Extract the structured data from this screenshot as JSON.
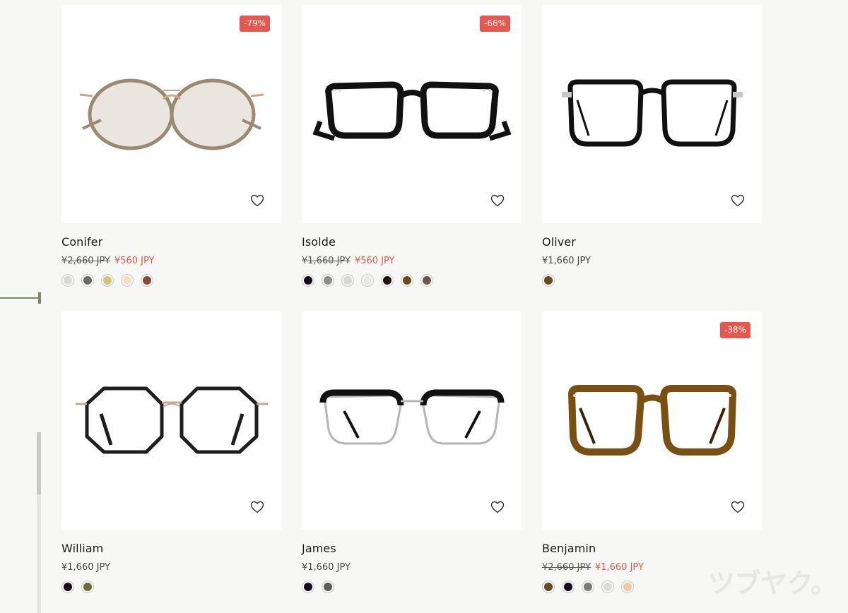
{
  "products": [
    {
      "name": "Conifer",
      "old_price": "¥2,660 JPY",
      "price": "¥560 JPY",
      "badge": "-79%",
      "frame": {
        "style": "round-metal",
        "lens": "#c4b7a4",
        "rim": "#9a8a72",
        "bridge": "#c8a78c"
      },
      "swatches": [
        "#d8d8d8",
        "#6a6a6a",
        "#d9c278",
        "#efe1c3",
        "#8b4a33"
      ]
    },
    {
      "name": "Isolde",
      "old_price": "¥1,660 JPY",
      "price": "¥560 JPY",
      "badge": "-66%",
      "frame": {
        "style": "rect-black",
        "lens": "#ffffff",
        "rim": "#111111",
        "bridge": "#111111"
      },
      "swatches": [
        "#160a1e",
        "#8e8e8e",
        "#d7d7d7",
        "#e8e8e8",
        "#1e1210",
        "#6d4a1c",
        "#6a5750"
      ]
    },
    {
      "name": "Oliver",
      "old_price": "",
      "price": "¥1,660 JPY",
      "badge": "",
      "frame": {
        "style": "square-black",
        "lens": "#ffffff",
        "rim": "#111111",
        "bridge": "#111111"
      },
      "swatches": [
        "#6a4a1e"
      ]
    },
    {
      "name": "William",
      "old_price": "",
      "price": "¥1,660 JPY",
      "badge": "",
      "frame": {
        "style": "octagon-thin",
        "lens": "#ffffff",
        "rim": "#1e1e1e",
        "bridge": "#c8a78c"
      },
      "swatches": [
        "#1a0d1e",
        "#6f6a3a"
      ]
    },
    {
      "name": "James",
      "old_price": "",
      "price": "¥1,660 JPY",
      "badge": "",
      "frame": {
        "style": "browline",
        "lens": "#ffffff",
        "rim": "#111111",
        "bridge": "#b5b5b5"
      },
      "swatches": [
        "#160a1e",
        "#5b5b5b"
      ]
    },
    {
      "name": "Benjamin",
      "old_price": "¥2,660 JPY",
      "price": "¥1,660 JPY",
      "badge": "-38%",
      "frame": {
        "style": "square-tortoise",
        "lens": "#ffffff",
        "rim": "#7a4f12",
        "bridge": "#7a4f12"
      },
      "swatches": [
        "#6a4a1e",
        "#140a1a",
        "#7a7a7a",
        "#dcdcdc",
        "#f5c7a3"
      ]
    }
  ],
  "watermark": "ツブヤク。"
}
